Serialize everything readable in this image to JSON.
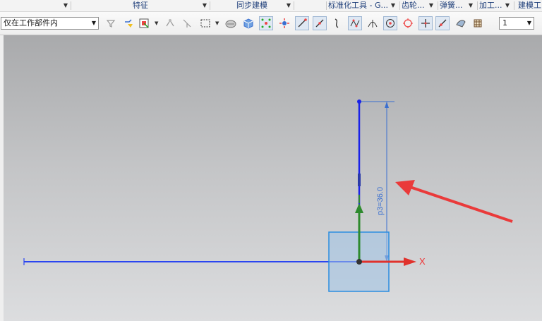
{
  "groups": [
    {
      "label": ""
    },
    {
      "label": "特征"
    },
    {
      "label": "同步建模"
    },
    {
      "label": ""
    },
    {
      "label": "标准化工具 - G..."
    },
    {
      "label": "齿轮..."
    },
    {
      "label": "弹簧..."
    },
    {
      "label": "加工..."
    },
    {
      "label": "建模工"
    }
  ],
  "toolbar": {
    "selection_filter": "仅在工作部件内",
    "snap_count": "1"
  },
  "icons": [
    "filter-icon",
    "feature-filter-icon",
    "select-region-icon",
    "point-snap-icon",
    "point-construct-icon",
    "rect-select-icon",
    "shaded-body-icon",
    "solid-cube-icon",
    "selection-priority-icon",
    "rotate-component-icon",
    "end-point-icon",
    "mid-point-icon",
    "curve-point-icon",
    "control-point-icon",
    "intersection-icon",
    "arc-center-icon",
    "quadrant-icon",
    "exist-point-icon",
    "on-curve-point-icon",
    "surface-point-icon",
    "grid-icon"
  ],
  "viewport": {
    "dimension_label": "p3=36.0",
    "x_axis_label": "X",
    "colors": {
      "x_axis": "#e0322c",
      "y_axis": "#2e8a2e",
      "sketch_line": "#1a33ff",
      "dimension": "#3a6fd0",
      "handle": "#9ec2e6",
      "arrow": "#ea3a3a"
    }
  }
}
